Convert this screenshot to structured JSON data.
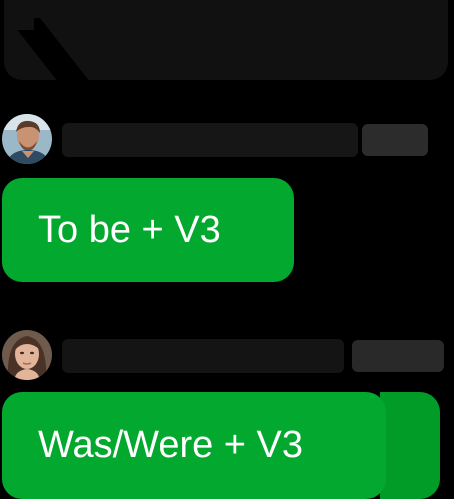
{
  "previous_message": {
    "text": ""
  },
  "messages": [
    {
      "sender": "",
      "time": "",
      "text": "To be + V3"
    },
    {
      "sender": "",
      "time": "",
      "text": "Was/Were + V3"
    }
  ],
  "colors": {
    "background": "#000000",
    "bubble_green": "#03a82e",
    "bubble_text": "#ffffff",
    "timestamp_gray": "#8a8a8a"
  }
}
